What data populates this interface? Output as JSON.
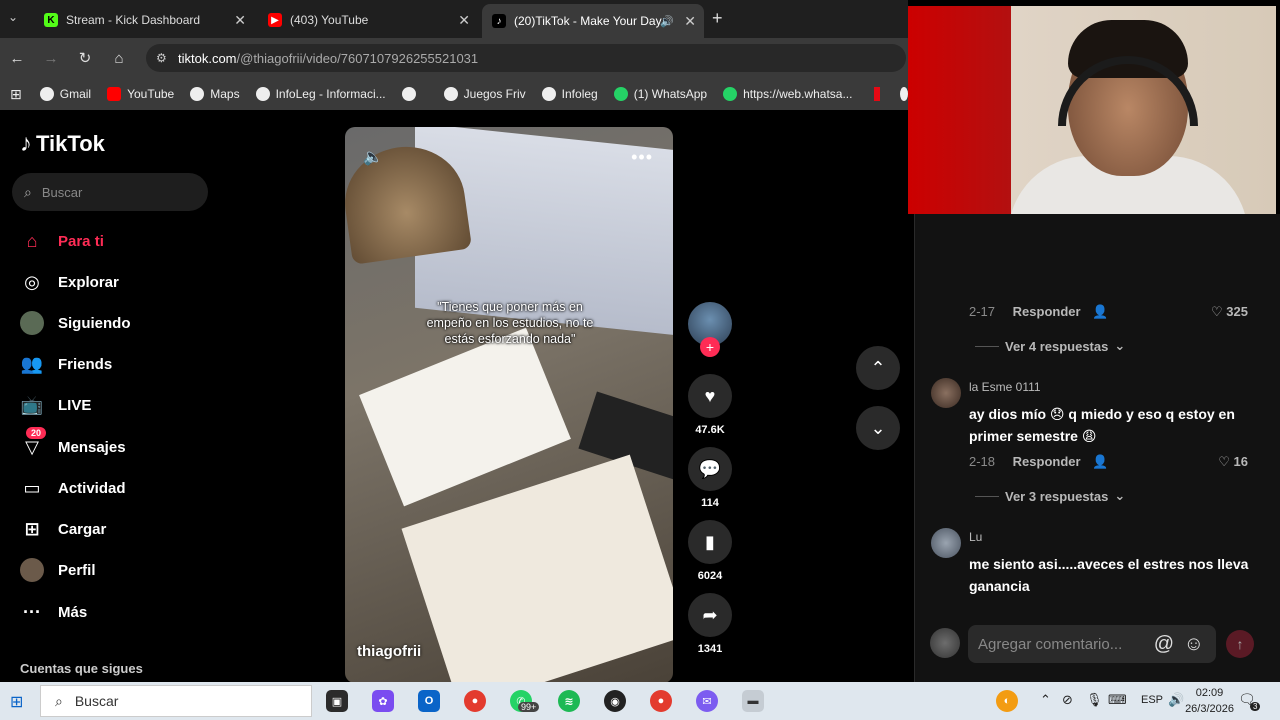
{
  "browser": {
    "tabs": [
      {
        "title": "Stream - Kick Dashboard",
        "active": false
      },
      {
        "title": "(403) YouTube",
        "active": false
      },
      {
        "title": "(20)TikTok - Make Your Day",
        "active": true
      }
    ],
    "url_host": "tiktok.com",
    "url_path": "/@thiagofrii/video/7607107926255521031",
    "bookmarks": [
      "Gmail",
      "YouTube",
      "Maps",
      "InfoLeg - Informaci...",
      "",
      "Juegos Friv",
      "Infoleg",
      "(1) WhatsApp",
      "https://web.whatsa..."
    ]
  },
  "tiktok": {
    "logo": "TikTok",
    "search_placeholder": "Buscar",
    "nav": [
      {
        "label": "Para ti",
        "icon": "home-icon"
      },
      {
        "label": "Explorar",
        "icon": "compass-icon"
      },
      {
        "label": "Siguiendo",
        "icon": "following-icon"
      },
      {
        "label": "Friends",
        "icon": "friends-icon"
      },
      {
        "label": "LIVE",
        "icon": "live-icon"
      },
      {
        "label": "Mensajes",
        "icon": "messages-icon",
        "badge": "20"
      },
      {
        "label": "Actividad",
        "icon": "activity-icon"
      },
      {
        "label": "Cargar",
        "icon": "upload-icon"
      },
      {
        "label": "Perfil",
        "icon": "profile-icon"
      },
      {
        "label": "Más",
        "icon": "more-icon"
      }
    ],
    "following_header": "Cuentas que sigues",
    "video": {
      "caption": "\"Tienes que poner más en empeño en los estudios, no te estás esforzando nada\"",
      "author": "thiagofrii"
    },
    "actions": {
      "likes": "47.6K",
      "comments": "114",
      "saves": "6024",
      "shares": "1341"
    }
  },
  "comments": {
    "items": [
      {
        "date": "2-17",
        "reply": "Responder",
        "likes": "325"
      },
      {
        "viewreplies": "Ver 4 respuestas"
      },
      {
        "name": "la Esme 0111",
        "text": "ay dios mío 😞 q miedo y eso q estoy en primer semestre 😩",
        "date": "2-18",
        "reply": "Responder",
        "likes": "16"
      },
      {
        "viewreplies": "Ver 3 respuestas"
      },
      {
        "name": "Lu",
        "text": "me siento asi.....aveces el estres nos lleva ganancia"
      }
    ],
    "input_placeholder": "Agregar comentario...",
    "mention_symbol": "@",
    "emoji_symbol": "☺"
  },
  "taskbar": {
    "search": "Buscar",
    "whatsapp_badge": "99+",
    "language": "ESP",
    "time": "02:09",
    "date": "26/3/2026",
    "notifications": "3"
  }
}
